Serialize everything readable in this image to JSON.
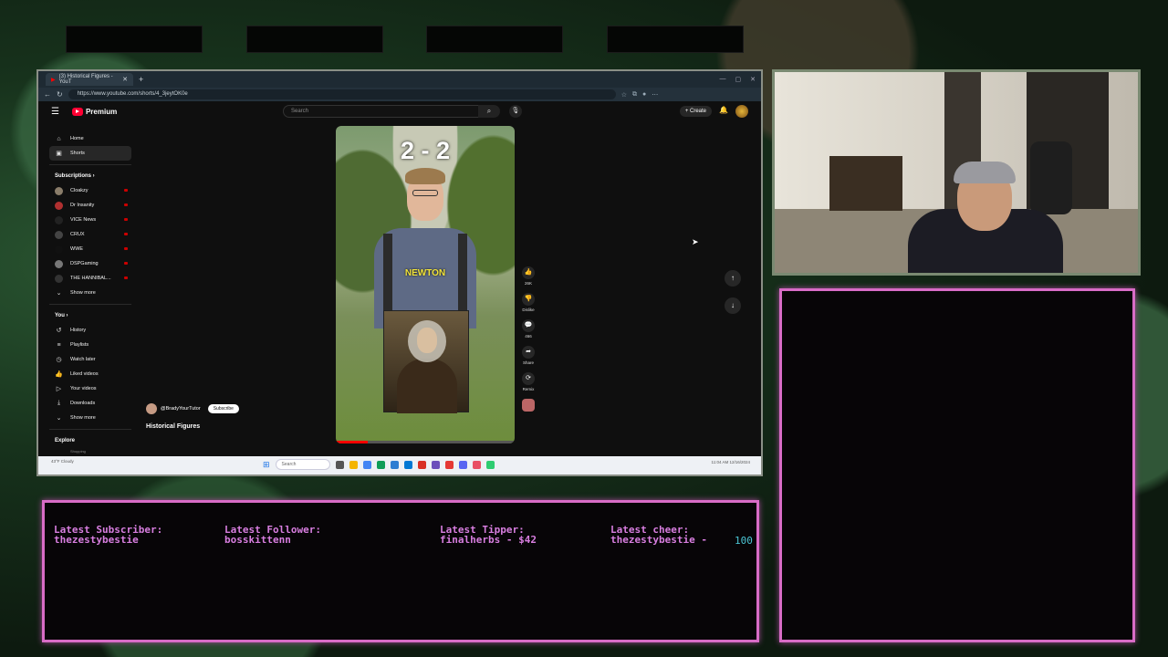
{
  "browser": {
    "tab_title": "(3) Historical Figures - YouT",
    "new_tab": "+",
    "url": "https://www.youtube.com/shorts/4_3jeytOK0e",
    "window_controls": [
      "—",
      "▢",
      "✕"
    ]
  },
  "youtube": {
    "brand": "Premium",
    "search_placeholder": "Search",
    "create_label": "Create",
    "sidebar": {
      "main": [
        {
          "label": "Home",
          "icon": "home-icon"
        },
        {
          "label": "Shorts",
          "icon": "shorts-icon"
        }
      ],
      "subscriptions_title": "Subscriptions",
      "subscriptions": [
        {
          "label": "Cloakzy",
          "color": "#8a7d6a"
        },
        {
          "label": "Dr Insanity",
          "color": "#b03030"
        },
        {
          "label": "VICE News",
          "color": "#222222"
        },
        {
          "label": "CRUX",
          "color": "#444444"
        },
        {
          "label": "WWE",
          "color": "#111111"
        },
        {
          "label": "DSPGaming",
          "color": "#777777"
        },
        {
          "label": "THE HANNIBAL...",
          "color": "#333333"
        }
      ],
      "show_more": "Show more",
      "you_title": "You",
      "you_items": [
        {
          "label": "History",
          "icon": "history-icon"
        },
        {
          "label": "Playlists",
          "icon": "playlist-icon"
        },
        {
          "label": "Watch later",
          "icon": "clock-icon"
        },
        {
          "label": "Liked videos",
          "icon": "like-icon"
        },
        {
          "label": "Your videos",
          "icon": "video-icon"
        },
        {
          "label": "Downloads",
          "icon": "download-icon"
        }
      ],
      "show_more_2": "Show more",
      "explore_title": "Explore",
      "explore_first": "Shopping"
    },
    "short": {
      "score": "2 - 2",
      "name_label": "NEWTON",
      "channel": "@BradyYourTutor",
      "subscribe": "Subscribe",
      "title": "Historical Figures",
      "progress": 0.18
    },
    "actions": [
      {
        "icon": "like-icon",
        "label": "26K",
        "glyph": "👍"
      },
      {
        "icon": "dislike-icon",
        "label": "Dislike",
        "glyph": "👎"
      },
      {
        "icon": "comment-icon",
        "label": "466",
        "glyph": "💬"
      },
      {
        "icon": "share-icon",
        "label": "Share",
        "glyph": "➦"
      },
      {
        "icon": "remix-icon",
        "label": "Remix",
        "glyph": "⟳"
      }
    ]
  },
  "taskbar": {
    "weather": "43°F Cloudy",
    "search": "Search",
    "tray": "11:04 AM 12/16/2024",
    "app_colors": [
      "#555555",
      "#f4b400",
      "#4285f4",
      "#0f9d58",
      "#2d7dd2",
      "#0078d4",
      "#d93025",
      "#6b4fbb",
      "#e53935",
      "#5865f2",
      "#e94f64",
      "#2ecc71"
    ]
  },
  "alerts": {
    "subscriber_label": "Latest Subscriber:",
    "subscriber_value": "thezestybestie",
    "follower_label": "Latest Follower:",
    "follower_value": "bosskittenn",
    "tipper_label": "Latest Tipper:",
    "tipper_value": "finalherbs - $42",
    "cheer_label": "Latest cheer:",
    "cheer_value": "thezestybestie -",
    "cheer_amount": "100"
  }
}
